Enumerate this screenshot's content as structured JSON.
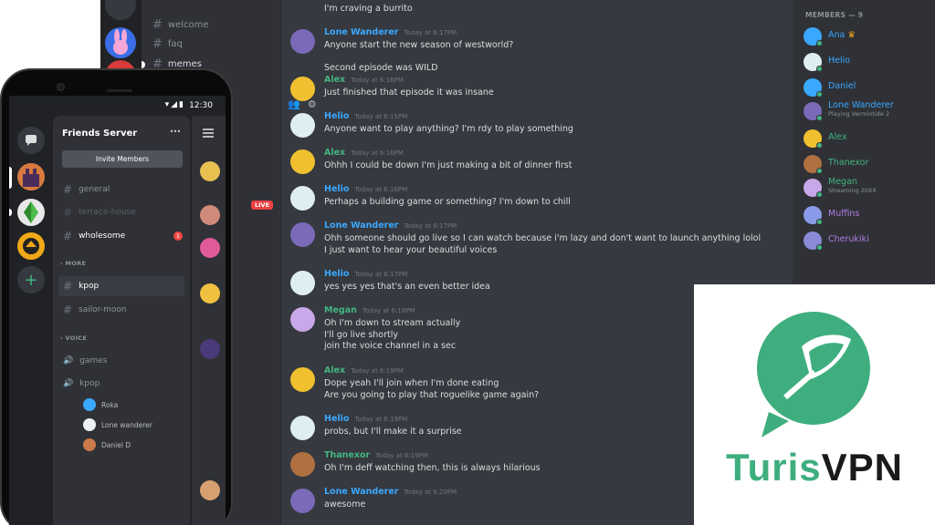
{
  "desktop": {
    "channels": [
      {
        "name": "welcome"
      },
      {
        "name": "faq"
      },
      {
        "name": "memes"
      }
    ],
    "live_badge": "LIVE",
    "messages": [
      {
        "author": "",
        "color": "#ffffff",
        "time": "",
        "lines": [
          "I'm craving a burrito"
        ],
        "continued": true
      },
      {
        "author": "Lone Wanderer",
        "color": "#3ba8ff",
        "time": "Today at 6:17PM",
        "lines": [
          "Anyone start the new season of westworld?",
          "",
          "Second episode was WILD"
        ]
      },
      {
        "author": "Alex",
        "color": "#43b581",
        "time": "Today at 6:16PM",
        "lines": [
          "Just finished that episode it was insane"
        ]
      },
      {
        "author": "Helio",
        "color": "#3ba8ff",
        "time": "Today at 6:15PM",
        "lines": [
          "Anyone want to play anything? I'm rdy to play something"
        ]
      },
      {
        "author": "Alex",
        "color": "#43b581",
        "time": "Today at 6:16PM",
        "lines": [
          "Ohhh I could be down I'm just making a bit of dinner first"
        ]
      },
      {
        "author": "Helio",
        "color": "#3ba8ff",
        "time": "Today at 6:16PM",
        "lines": [
          "Perhaps a building game or something? I'm down to chill"
        ]
      },
      {
        "author": "Lone Wanderer",
        "color": "#3ba8ff",
        "time": "Today at 6:17PM",
        "lines": [
          "Ohh someone should go live so I can watch because i'm lazy and don't want to launch anything lolol",
          "I just want to hear your beautiful voices"
        ]
      },
      {
        "author": "Helio",
        "color": "#3ba8ff",
        "time": "Today at 6:17PM",
        "lines": [
          "yes yes yes that's an even better idea"
        ]
      },
      {
        "author": "Megan",
        "color": "#43b581",
        "time": "Today at 6:18PM",
        "lines": [
          "Oh I'm down to stream actually",
          "I'll go live shortly",
          "join the voice channel in a sec"
        ]
      },
      {
        "author": "Alex",
        "color": "#43b581",
        "time": "Today at 6:19PM",
        "lines": [
          "Dope yeah I'll join when I'm done eating",
          "Are you going to play that roguelike game again?"
        ]
      },
      {
        "author": "Helio",
        "color": "#3ba8ff",
        "time": "Today at 6:19PM",
        "lines": [
          "probs, but I'll make it a surprise"
        ]
      },
      {
        "author": "Thanexor",
        "color": "#43b581",
        "time": "Today at 6:19PM",
        "lines": [
          "Oh I'm deff watching then, this is always hilarious"
        ]
      },
      {
        "author": "Lone Wanderer",
        "color": "#3ba8ff",
        "time": "Today at 6:20PM",
        "lines": [
          "awesome"
        ]
      }
    ],
    "members_header": "MEMBERS — 9",
    "members": [
      {
        "name": "Ana",
        "color": "#3ba8ff",
        "crown": "♛",
        "sub": ""
      },
      {
        "name": "Helio",
        "color": "#3ba8ff",
        "sub": ""
      },
      {
        "name": "Daniel",
        "color": "#3ba8ff",
        "sub": ""
      },
      {
        "name": "Lone Wanderer",
        "color": "#3ba8ff",
        "sub": "Playing Vermintide 2"
      },
      {
        "name": "Alex",
        "color": "#43b581",
        "sub": ""
      },
      {
        "name": "Thanexor",
        "color": "#43b581",
        "sub": ""
      },
      {
        "name": "Megan",
        "color": "#43b581",
        "sub": "Streaming 20XX"
      },
      {
        "name": "Muffins",
        "color": "#b47ee5",
        "sub": ""
      },
      {
        "name": "Cherukiki",
        "color": "#b47ee5",
        "sub": ""
      }
    ]
  },
  "phone": {
    "status_time": "12:30",
    "server_name": "Friends Server",
    "more_icon": "⋯",
    "invite_label": "Invite Members",
    "text_channels": [
      {
        "name": "general",
        "state": "normal"
      },
      {
        "name": "terrace-house",
        "state": "muted"
      },
      {
        "name": "wholesome",
        "state": "unread",
        "badge": "1"
      }
    ],
    "category_more": "MORE",
    "more_channels": [
      {
        "name": "kpop",
        "state": "active"
      },
      {
        "name": "sailor-moon",
        "state": "normal"
      }
    ],
    "category_voice": "VOICE",
    "voice_channels": [
      {
        "name": "games"
      },
      {
        "name": "kpop"
      }
    ],
    "voice_users": [
      {
        "name": "Roka"
      },
      {
        "name": "Lone wanderer"
      },
      {
        "name": "Daniel D"
      }
    ]
  },
  "logo": {
    "word_turis": "Turis",
    "word_vpn": "VPN",
    "color_green": "#3fae7e",
    "color_dark": "#1a1a1a"
  }
}
